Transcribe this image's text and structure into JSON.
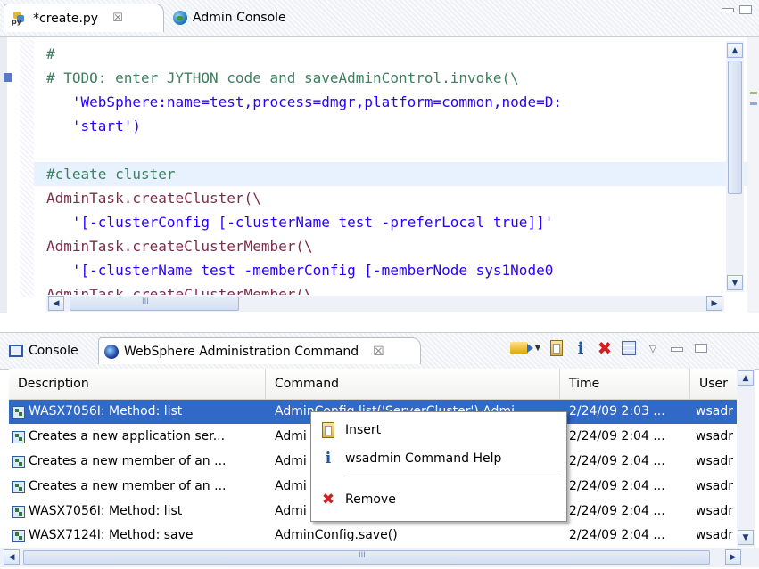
{
  "editor_tabs": [
    {
      "label": "*create.py",
      "close": "☒",
      "icon": "python-file-icon"
    },
    {
      "label": "Admin Console",
      "icon": "globe-icon"
    }
  ],
  "code_lines": [
    {
      "text": "#",
      "style": "comment"
    },
    {
      "text": "# TODO: enter JYTHON code and saveAdminControl.invoke(\\",
      "style": "comment"
    },
    {
      "text": "   'WebSphere:name=test,process=dmgr,platform=common,node=D:",
      "style": "str"
    },
    {
      "text": "   'start')",
      "style": "str"
    },
    {
      "text": "",
      "style": "plain"
    },
    {
      "text": "#cleate cluster",
      "style": "comment",
      "highlight": true
    },
    {
      "text": "AdminTask.createCluster(\\",
      "style": "fn"
    },
    {
      "text": "   '[-clusterConfig [-clusterName test -preferLocal true]]'",
      "style": "str"
    },
    {
      "text": "AdminTask.createClusterMember(\\",
      "style": "fn"
    },
    {
      "text": "   '[-clusterName test -memberConfig [-memberNode sys1Node0",
      "style": "str"
    },
    {
      "text": "AdminTask.createClusterMember(\\",
      "style": "fn"
    }
  ],
  "scrollbar_thumb_label": "III",
  "view_tabs": [
    {
      "label": "Console",
      "icon": "console-icon"
    },
    {
      "label": "WebSphere Administration Command",
      "close": "☒",
      "icon": "websphere-icon"
    }
  ],
  "toolbar_icons": [
    "run-command-icon",
    "dropdown-icon",
    "insert-icon",
    "info-icon",
    "remove-icon",
    "grid-icon",
    "view-menu-icon",
    "minimize-icon",
    "maximize-icon"
  ],
  "table": {
    "headers": [
      "Description",
      "Command",
      "Time",
      "User"
    ],
    "rows": [
      {
        "description": "WASX7056I: Method: list",
        "command": "AdminConfig.list('ServerCluster') Admi",
        "time": "2/24/09 2:03 ...",
        "user": "wsadr",
        "selected": true
      },
      {
        "description": "Creates a new application ser...",
        "command": "Admi",
        "time": "2/24/09 2:04 ...",
        "user": "wsadr"
      },
      {
        "description": "Creates a new member of an ...",
        "command": "Admi",
        "time": "2/24/09 2:04 ...",
        "user": "wsadr"
      },
      {
        "description": "Creates a new member of an ...",
        "command": "Admi",
        "time": "2/24/09 2:04 ...",
        "user": "wsadr"
      },
      {
        "description": "WASX7056I: Method: list",
        "command": "Admi",
        "time": "2/24/09 2:04 ...",
        "user": "wsadr"
      },
      {
        "description": "WASX7124I: Method: save",
        "command": "AdminConfig.save()",
        "time": "2/24/09 2:04 ...",
        "user": "wsadr"
      }
    ]
  },
  "context_menu": [
    {
      "label": "Insert",
      "icon": "insert-icon"
    },
    {
      "label": "wsadmin Command Help",
      "icon": "info-icon"
    },
    {
      "label": "Remove",
      "icon": "remove-icon"
    }
  ],
  "colors": {
    "selection": "#3169c6",
    "comment": "#3f7f5f",
    "string": "#2a00ff",
    "function": "#7f2c4a"
  }
}
